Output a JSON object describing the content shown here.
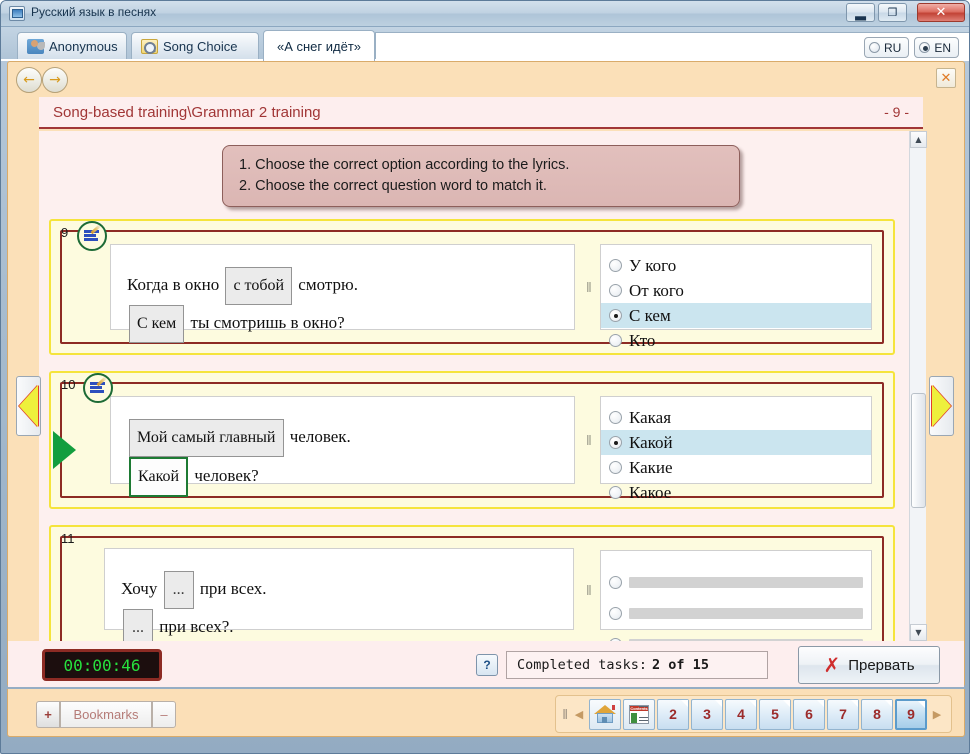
{
  "window": {
    "title": "Русский язык в песнях",
    "icon": "app-icon",
    "minimize_label": "—",
    "maximize_label": "❐",
    "close_label": "✕"
  },
  "tabs": [
    {
      "label": "Anonymous",
      "icon": "person-key-icon",
      "active": false
    },
    {
      "label": "Song Choice",
      "icon": "magnifier-icon",
      "active": false
    },
    {
      "label": "«А снег идёт»",
      "icon": "",
      "active": true
    }
  ],
  "language": {
    "options": [
      {
        "label": "RU",
        "selected": false
      },
      {
        "label": "EN",
        "selected": true
      }
    ]
  },
  "toolbar": {
    "back_icon": "arrow-left-icon",
    "forward_icon": "arrow-right-icon",
    "close_icon": "close-icon",
    "close_label": "✕"
  },
  "header": {
    "breadcrumb": "Song-based training\\Grammar 2 training",
    "page_indicator": "- 9 -"
  },
  "instructions": {
    "line1": "1. Choose the correct option according to the lyrics.",
    "line2": "2. Choose the correct question word to match it."
  },
  "questions": [
    {
      "number": "9",
      "badge_icon": "task-edit-icon",
      "sentences": [
        {
          "parts": [
            {
              "type": "text",
              "value": "Когда в окно"
            },
            {
              "type": "blank",
              "value": "с тобой",
              "state": "filled"
            },
            {
              "type": "text",
              "value": "смотрю."
            }
          ]
        },
        {
          "parts": [
            {
              "type": "blank",
              "value": "С кем",
              "state": "filled"
            },
            {
              "type": "text",
              "value": "ты смотришь в окно?"
            }
          ]
        }
      ],
      "options": [
        {
          "label": "У кого",
          "selected": false
        },
        {
          "label": "От кого",
          "selected": false
        },
        {
          "label": "С кем",
          "selected": true
        },
        {
          "label": "Кто",
          "selected": false
        }
      ]
    },
    {
      "number": "10",
      "badge_icon": "task-edit-icon",
      "sentences": [
        {
          "parts": [
            {
              "type": "blank",
              "value": "Мой самый главный",
              "state": "filled"
            },
            {
              "type": "text",
              "value": "человек."
            }
          ]
        },
        {
          "parts": [
            {
              "type": "blank",
              "value": "Какой",
              "state": "correct"
            },
            {
              "type": "text",
              "value": "человек?"
            }
          ]
        }
      ],
      "options": [
        {
          "label": "Какая",
          "selected": false
        },
        {
          "label": "Какой",
          "selected": true
        },
        {
          "label": "Какие",
          "selected": false
        },
        {
          "label": "Какое",
          "selected": false
        }
      ]
    },
    {
      "number": "11",
      "badge_icon": "",
      "sentences": [
        {
          "parts": [
            {
              "type": "text",
              "value": "Хочу"
            },
            {
              "type": "blank",
              "value": "...",
              "state": "empty"
            },
            {
              "type": "text",
              "value": "при всех."
            }
          ]
        },
        {
          "parts": [
            {
              "type": "blank",
              "value": "...",
              "state": "empty"
            },
            {
              "type": "text",
              "value": "при всех?."
            }
          ]
        }
      ],
      "options": [
        {
          "label": "",
          "selected": false
        },
        {
          "label": "",
          "selected": false
        },
        {
          "label": "",
          "selected": false
        }
      ]
    }
  ],
  "side_nav": {
    "prev_icon": "triangle-left-icon",
    "next_icon": "triangle-right-icon",
    "play_icon": "triangle-play-icon"
  },
  "status": {
    "timer": "00:00:46",
    "help_label": "?",
    "completed_label": "Completed tasks:",
    "completed_value": "2 of 15",
    "abort_label": "Прервать",
    "abort_icon": "x-mark-icon"
  },
  "bookmarks": {
    "add_label": "+",
    "label": "Bookmarks",
    "remove_label": "–"
  },
  "pager": {
    "splitter": "‖",
    "prev_icon": "chevron-left-icon",
    "next_icon": "chevron-right-icon",
    "home_icon": "home-icon",
    "contents_icon": "contents-icon",
    "contents_title": "Contents",
    "pages": [
      "2",
      "3",
      "4",
      "5",
      "6",
      "7",
      "8",
      "9"
    ],
    "current_page": "9"
  },
  "colors": {
    "accent_red": "#a13636",
    "card_border": "#8d2b24",
    "card_outline": "#f5e43c",
    "card_bg": "#fdfbdf",
    "selection": "#cbe5ef",
    "correct_green": "#1d7a33",
    "page_bg": "#fdf0ef",
    "window_bg": "#fbe0b8",
    "timer_green": "#27e03e"
  }
}
